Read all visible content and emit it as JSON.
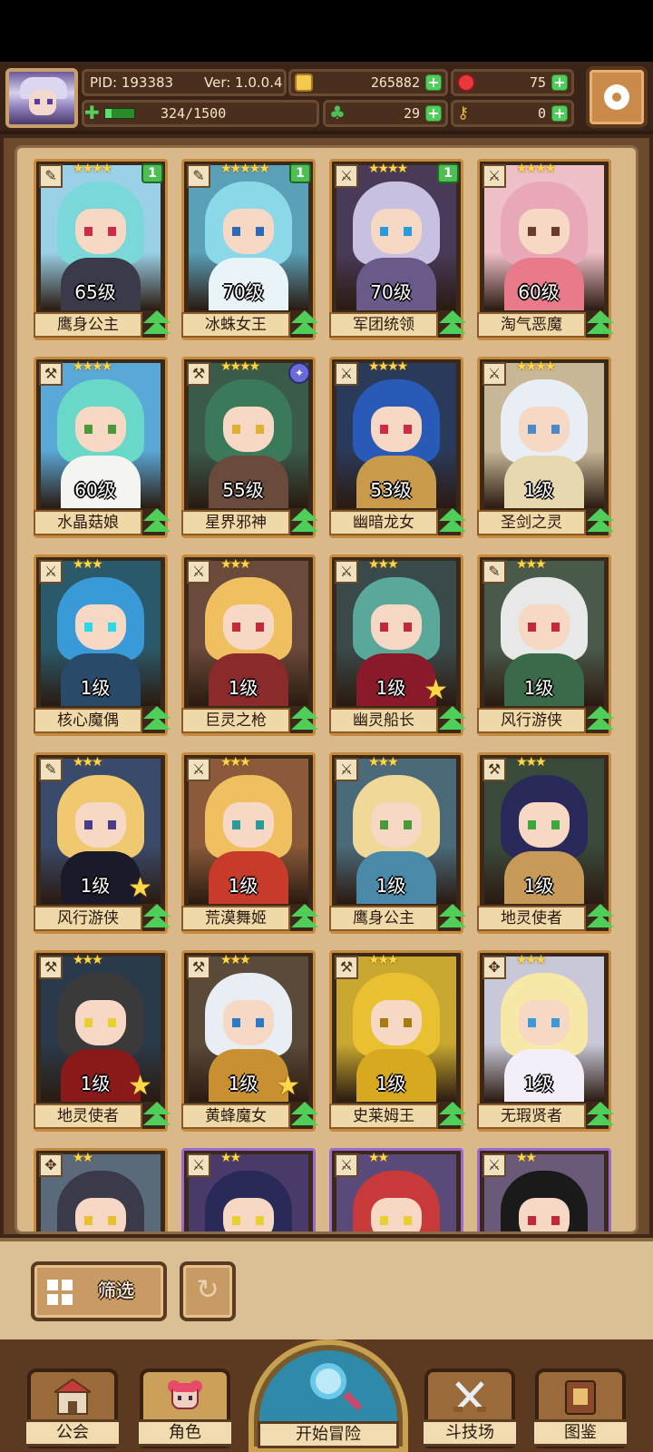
{
  "header": {
    "pid": "PID: 193383",
    "version": "Ver: 1.0.0.4",
    "coins": "265882",
    "gems": "75",
    "energy": "324/1500",
    "energy_fraction": 0.216,
    "clovers": "29",
    "keys": "0"
  },
  "heroes": [
    {
      "level": "65级",
      "name": "鹰身公主",
      "stars": "★★★★",
      "badge": "1",
      "hair": "#7ad8d8",
      "body": "#3a3a4a",
      "bg": "#9ad0e8",
      "eye": "#d02a4a",
      "border": "gold",
      "bigstar": false,
      "type": "✎"
    },
    {
      "level": "70级",
      "name": "冰蛛女王",
      "stars": "★★★★★",
      "badge": "1",
      "hair": "#8ad8e8",
      "body": "#e8f4f8",
      "bg": "#5aa0b8",
      "eye": "#2a6ab8",
      "border": "gold",
      "bigstar": false,
      "type": "✎"
    },
    {
      "level": "70级",
      "name": "军团统领",
      "stars": "★★★★",
      "badge": "1",
      "hair": "#c8c0e0",
      "body": "#6a5a8a",
      "bg": "#4a3a5a",
      "eye": "#2a9ae0",
      "border": "gold",
      "bigstar": false,
      "type": "⚔"
    },
    {
      "level": "60级",
      "name": "淘气恶魔",
      "stars": "★★★★",
      "badge": "",
      "hair": "#e8a8b8",
      "body": "#e87a8a",
      "bg": "#f0c0c8",
      "eye": "#6a3a2a",
      "border": "gold",
      "bigstar": false,
      "type": "⚔"
    },
    {
      "level": "60级",
      "name": "水晶菇娘",
      "stars": "★★★★",
      "badge": "",
      "hair": "#6ad8c8",
      "body": "#f4f4f0",
      "bg": "#5aa8d8",
      "eye": "#4a9a3a",
      "border": "gold",
      "bigstar": false,
      "type": "⚒"
    },
    {
      "level": "55级",
      "name": "星界邪神",
      "stars": "★★★★",
      "badge": "orb",
      "hair": "#3a7a5a",
      "body": "#6a4a3a",
      "bg": "#3a5a4a",
      "eye": "#e0b030",
      "border": "gold",
      "bigstar": false,
      "type": "⚒"
    },
    {
      "level": "53级",
      "name": "幽暗龙女",
      "stars": "★★★★",
      "badge": "",
      "hair": "#2a5ab8",
      "body": "#c89a4a",
      "bg": "#2a3a5a",
      "eye": "#d02a4a",
      "border": "gold",
      "bigstar": false,
      "type": "⚔"
    },
    {
      "level": "1级",
      "name": "圣剑之灵",
      "stars": "★★★★",
      "badge": "",
      "hair": "#e8eef4",
      "body": "#e8d8b0",
      "bg": "#c8b898",
      "eye": "#4a8ac8",
      "border": "gold",
      "bigstar": false,
      "type": "⚔"
    },
    {
      "level": "1级",
      "name": "核心魔偶",
      "stars": "★★★",
      "badge": "",
      "hair": "#3a9ad8",
      "body": "#2a4a6a",
      "bg": "#2a5a6a",
      "eye": "#2ad8e8",
      "border": "gold",
      "bigstar": false,
      "type": "⚔"
    },
    {
      "level": "1级",
      "name": "巨灵之枪",
      "stars": "★★★",
      "badge": "",
      "hair": "#f0c060",
      "body": "#8a2a2a",
      "bg": "#6a4a3a",
      "eye": "#c02a3a",
      "border": "gold",
      "bigstar": false,
      "type": "⚔"
    },
    {
      "level": "1级",
      "name": "幽灵船长",
      "stars": "★★★",
      "badge": "",
      "hair": "#5aa89a",
      "body": "#8a1a2a",
      "bg": "#3a4a4a",
      "eye": "#c02a3a",
      "border": "gold",
      "bigstar": true,
      "type": "⚔"
    },
    {
      "level": "1级",
      "name": "风行游侠",
      "stars": "★★★",
      "badge": "",
      "hair": "#e8e8e8",
      "body": "#3a6a4a",
      "bg": "#4a5a4a",
      "eye": "#c02a3a",
      "border": "gold",
      "bigstar": false,
      "type": "✎"
    },
    {
      "level": "1级",
      "name": "风行游侠",
      "stars": "★★★",
      "badge": "",
      "hair": "#f0c870",
      "body": "#1a1a2a",
      "bg": "#3a4a6a",
      "eye": "#4a3a8a",
      "border": "gold",
      "bigstar": true,
      "type": "✎"
    },
    {
      "level": "1级",
      "name": "荒漠舞姬",
      "stars": "★★★",
      "badge": "",
      "hair": "#f0c060",
      "body": "#c83a2a",
      "bg": "#8a5a3a",
      "eye": "#2a9a9a",
      "border": "gold",
      "bigstar": false,
      "type": "⚔"
    },
    {
      "level": "1级",
      "name": "鹰身公主",
      "stars": "★★★",
      "badge": "",
      "hair": "#f0d898",
      "body": "#4a8aa8",
      "bg": "#4a6a7a",
      "eye": "#4a9a3a",
      "border": "gold",
      "bigstar": false,
      "type": "⚔"
    },
    {
      "level": "1级",
      "name": "地灵使者",
      "stars": "★★★",
      "badge": "",
      "hair": "#2a2a5a",
      "body": "#c89a5a",
      "bg": "#3a4a3a",
      "eye": "#3aa83a",
      "border": "gold",
      "bigstar": false,
      "type": "⚒"
    },
    {
      "level": "1级",
      "name": "地灵使者",
      "stars": "★★★",
      "badge": "",
      "hair": "#3a3a3a",
      "body": "#8a1a1a",
      "bg": "#2a3a4a",
      "eye": "#e8d030",
      "border": "gold",
      "bigstar": true,
      "type": "⚒"
    },
    {
      "level": "1级",
      "name": "黄蜂魔女",
      "stars": "★★★",
      "badge": "",
      "hair": "#e8eef4",
      "body": "#c89030",
      "bg": "#5a4a3a",
      "eye": "#2a7ac8",
      "border": "gold",
      "bigstar": true,
      "type": "⚒"
    },
    {
      "level": "1级",
      "name": "史莱姆王",
      "stars": "★★★",
      "badge": "",
      "hair": "#e8c030",
      "body": "#d8a820",
      "bg": "#c8a830",
      "eye": "#a87a10",
      "border": "gold",
      "bigstar": false,
      "type": "⚒"
    },
    {
      "level": "1级",
      "name": "无瑕贤者",
      "stars": "★★★",
      "badge": "",
      "hair": "#f8e8a8",
      "body": "#f4eef8",
      "bg": "#c8c8d8",
      "eye": "#3a9ad8",
      "border": "gold",
      "bigstar": false,
      "type": "✥"
    },
    {
      "level": "",
      "name": "",
      "stars": "★★",
      "badge": "",
      "hair": "#3a3a4a",
      "body": "#3a3a4a",
      "bg": "#5a6a7a",
      "eye": "#e8c030",
      "border": "gold",
      "bigstar": false,
      "type": "✥"
    },
    {
      "level": "",
      "name": "",
      "stars": "★★",
      "badge": "",
      "hair": "#2a2a5a",
      "body": "#3a8a3a",
      "bg": "#4a3a6a",
      "eye": "#e8d030",
      "border": "purple",
      "bigstar": false,
      "type": "⚔"
    },
    {
      "level": "",
      "name": "",
      "stars": "★★",
      "badge": "",
      "hair": "#c83a3a",
      "body": "#5a2a2a",
      "bg": "#5a4a7a",
      "eye": "#e8d030",
      "border": "purple",
      "bigstar": false,
      "type": "⚔"
    },
    {
      "level": "",
      "name": "",
      "stars": "★★",
      "badge": "",
      "hair": "#1a1a1a",
      "body": "#f4f0f0",
      "bg": "#6a5a7a",
      "eye": "#c02a3a",
      "border": "purple",
      "bigstar": false,
      "type": "⚔"
    }
  ],
  "bottom": {
    "filter_label": "筛选",
    "tabs": {
      "guild": "公会",
      "role": "角色",
      "adventure": "开始冒险",
      "arena": "斗技场",
      "dex": "图鉴"
    }
  }
}
